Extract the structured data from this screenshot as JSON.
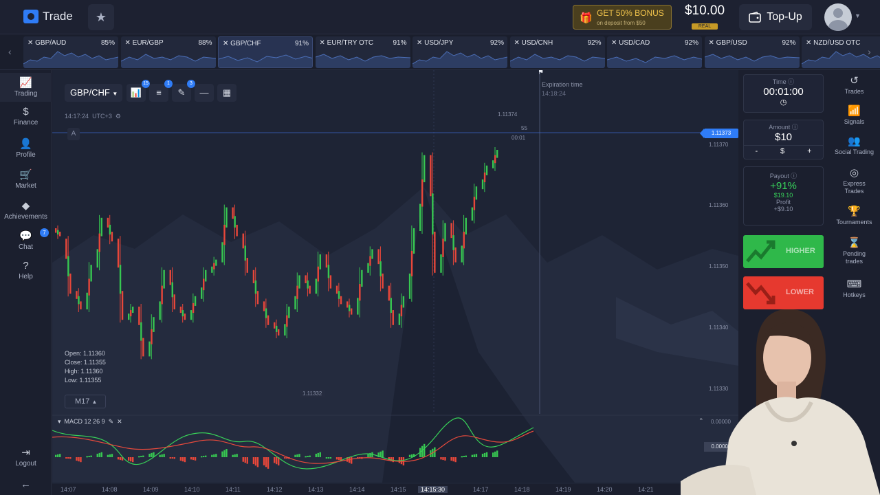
{
  "header": {
    "logo_text": "Trade",
    "bonus_title": "GET 50% BONUS",
    "bonus_sub": "on deposit from $50",
    "balance": "$10.00",
    "balance_badge": "REAL",
    "topup_label": "Top-Up"
  },
  "pairs": [
    {
      "name": "✕ GBP/AUD",
      "pct": "85%"
    },
    {
      "name": "✕ EUR/GBP",
      "pct": "88%"
    },
    {
      "name": "✕ GBP/CHF",
      "pct": "91%"
    },
    {
      "name": "✕ EUR/TRY OTC",
      "pct": "91%"
    },
    {
      "name": "✕ USD/JPY",
      "pct": "92%"
    },
    {
      "name": "✕ USD/CNH",
      "pct": "92%"
    },
    {
      "name": "✕ USD/CAD",
      "pct": "92%"
    },
    {
      "name": "✕ GBP/USD",
      "pct": "92%"
    },
    {
      "name": "✕ NZD/USD OTC",
      "pct": ""
    }
  ],
  "left_nav": {
    "trading": "Trading",
    "finance": "Finance",
    "profile": "Profile",
    "market": "Market",
    "achievements": "Achievements",
    "chat": "Chat",
    "chat_badge": "7",
    "help": "Help",
    "logout": "Logout"
  },
  "chart": {
    "symbol": "GBP/CHF",
    "tool_badges": [
      "15",
      "1",
      "3"
    ],
    "server_time": "14:17:24",
    "timezone": "UTC+3",
    "marker": "A",
    "expiration_label": "Expiration time",
    "expiration_time": "14:18:24",
    "top_price": "1.11374",
    "countdown_s": "55",
    "countdown_t": "00:01",
    "current_price": "1.11373",
    "low_marker": "1.11332",
    "ohlc": [
      "Open: 1.11360",
      "Close: 1.11355",
      "High: 1.11360",
      "Low: 1.11355"
    ],
    "timeframe": "M17",
    "y_labels": [
      "1.11370",
      "1.11360",
      "1.11350",
      "1.11340",
      "1.11330"
    ],
    "macd_title": "MACD 12 26 9",
    "macd_zero": "0.00000",
    "macd_value": "0.00002",
    "x_labels": [
      "14:07",
      "14:08",
      "14:09",
      "14:10",
      "14:11",
      "14:12",
      "14:13",
      "14:14",
      "14:15",
      "14:15:30",
      "14:17",
      "14:18",
      "14:19",
      "14:20",
      "14:21"
    ]
  },
  "chart_data": {
    "type": "candlestick",
    "title": "GBP/CHF",
    "ylim": [
      1.11328,
      1.11378
    ],
    "candles": [
      [
        1.11358,
        1.11357
      ],
      [
        1.11356,
        1.11346
      ],
      [
        1.11346,
        1.11343
      ],
      [
        1.11343,
        1.11351
      ],
      [
        1.11351,
        1.1136
      ],
      [
        1.1136,
        1.11356
      ],
      [
        1.11356,
        1.11341
      ],
      [
        1.11341,
        1.11343
      ],
      [
        1.11343,
        1.11334
      ],
      [
        1.11334,
        1.11341
      ],
      [
        1.11341,
        1.1135
      ],
      [
        1.1135,
        1.11343
      ],
      [
        1.11343,
        1.11341
      ],
      [
        1.11341,
        1.11345
      ],
      [
        1.11345,
        1.1135
      ],
      [
        1.1135,
        1.11352
      ],
      [
        1.11352,
        1.11362
      ],
      [
        1.11362,
        1.11357
      ],
      [
        1.11357,
        1.1135
      ],
      [
        1.1135,
        1.11344
      ],
      [
        1.11344,
        1.1134
      ],
      [
        1.1134,
        1.11338
      ],
      [
        1.11338,
        1.11343
      ],
      [
        1.11343,
        1.11349
      ],
      [
        1.11349,
        1.11346
      ],
      [
        1.11346,
        1.11353
      ],
      [
        1.11353,
        1.11347
      ],
      [
        1.11347,
        1.11344
      ],
      [
        1.11344,
        1.11342
      ],
      [
        1.11342,
        1.1135
      ],
      [
        1.1135,
        1.11354
      ],
      [
        1.11354,
        1.11347
      ],
      [
        1.11347,
        1.1134
      ],
      [
        1.1134,
        1.11345
      ],
      [
        1.11345,
        1.11358
      ],
      [
        1.11358,
        1.11372
      ],
      [
        1.11372,
        1.1135
      ],
      [
        1.1135,
        1.11359
      ],
      [
        1.11359,
        1.11352
      ],
      [
        1.11352,
        1.1136
      ],
      [
        1.1136,
        1.11366
      ],
      [
        1.11366,
        1.1137
      ],
      [
        1.1137,
        1.11373
      ]
    ],
    "macd": [
      0.2,
      -0.1,
      -0.3,
      0.1,
      0.3,
      0.2,
      -0.2,
      -0.3,
      0.1,
      0.3,
      0.2,
      -0.1,
      -0.3,
      -0.2,
      0.1,
      0.2,
      0.5,
      0.2,
      -0.4,
      -0.6,
      -0.7,
      -0.5,
      -0.1,
      0.2,
      0.1,
      0.3,
      0.0,
      -0.2,
      -0.4,
      -0.1,
      0.3,
      0.4,
      -0.3,
      -0.5,
      0.2,
      0.8,
      0.6,
      -0.2,
      -0.3,
      0.1,
      0.2,
      0.3,
      0.4
    ]
  }
}
